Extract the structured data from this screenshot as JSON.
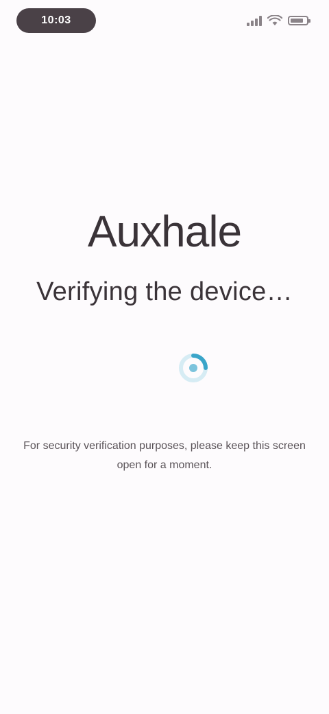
{
  "status_bar": {
    "time": "10:03",
    "battery_percent": 80,
    "signal_bars": 4,
    "color": "#8a8388",
    "pill_color": "#4a4147"
  },
  "main": {
    "brand": "Auxhale",
    "heading": "Verifying the device…",
    "note": "For security verification purposes, please keep this screen open for a moment."
  },
  "colors": {
    "background": "#fdfbfd",
    "text": "#3a3338",
    "spinner": "#3aa5c9"
  },
  "icons": {
    "spinner": "loading-spinner-icon"
  }
}
